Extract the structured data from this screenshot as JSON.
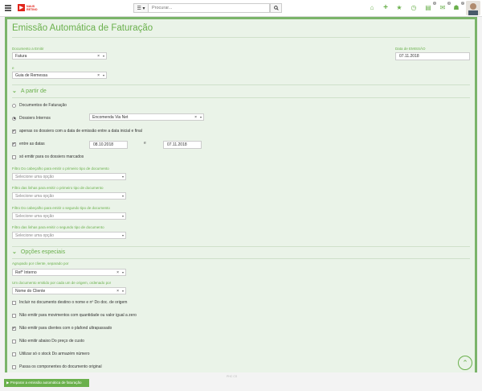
{
  "header": {
    "logo_text_1": "NAUS",
    "logo_text_2": "RETINO",
    "search_menu_label": "☰ ▾",
    "search_placeholder": "Procurar...",
    "icons": [
      "home-icon",
      "plus-icon",
      "star-icon",
      "clock-icon",
      "docs-icon",
      "mail-icon",
      "users-icon"
    ],
    "badges": {
      "docs": "1",
      "mail": "3",
      "users": "7"
    }
  },
  "page": {
    "title": "Emissão Automática de Faturação",
    "doc_emit_label": "Documento a Emitir",
    "doc_emit_value": "Fatura",
    "date_label": "Data de EMISSÃO",
    "date_value": "07.11.2018",
    "e_label": "e",
    "e_value": "Guia de Remessa"
  },
  "section1": {
    "title": "A partir de",
    "opt_faturacao": "Documentos de Faturação",
    "opt_dossiers": "Dossiers Internos",
    "dossiers_value": "Encomenda Via Net",
    "opt_apenas": "apenas os dossiers com a data de emissão entre a data inicial e final",
    "opt_entre": "entre as datas",
    "date_from": "08.10.2018",
    "date_to": "07.11.2018",
    "e_between": "e",
    "opt_marcados": "só emitir para os dossiers marcados",
    "filters": [
      {
        "label": "Filtro Do cabeçalho para emitir o primeiro tipo de documento",
        "placeholder": "Selecione uma opção"
      },
      {
        "label": "Filtro das linhas para emitir o primeiro tipo de documento",
        "placeholder": "Selecione uma opção"
      },
      {
        "label": "Filtro Do cabeçalho para emitir o segundo tipo de documento",
        "placeholder": "Selecione uma opção"
      },
      {
        "label": "Filtro das linhas para emitir o segundo tipo de documento",
        "placeholder": "Selecione uma opção"
      }
    ]
  },
  "section2": {
    "title": "Opções especiais",
    "agrupado_label": "Agrupado por cliente, separado por",
    "agrupado_value": "Ref* Interno",
    "um_doc_label": "Um documento emitido por cada um de origem, ordenado por",
    "um_doc_value": "Nome do Cliente",
    "checks": [
      {
        "label": "Incluir no documento destino o nome e nº Do doc. de origem",
        "checked": false
      },
      {
        "label": "Não emitir para movimentos com quantidade ou valor igual a zero",
        "checked": false
      },
      {
        "label": "Não emitir para clientes com o plafond ultrapassado",
        "checked": true
      },
      {
        "label": "Não emitir abaixo Do preço de custo",
        "checked": false
      },
      {
        "label": "Utilizar só o stock Do armazém número",
        "checked": false
      },
      {
        "label": "Passa os componentes do documento original",
        "checked": false
      }
    ]
  },
  "footer": {
    "button_label": "▶ Preparar a emissão automática de faturação",
    "small_text": "PHC CS"
  }
}
